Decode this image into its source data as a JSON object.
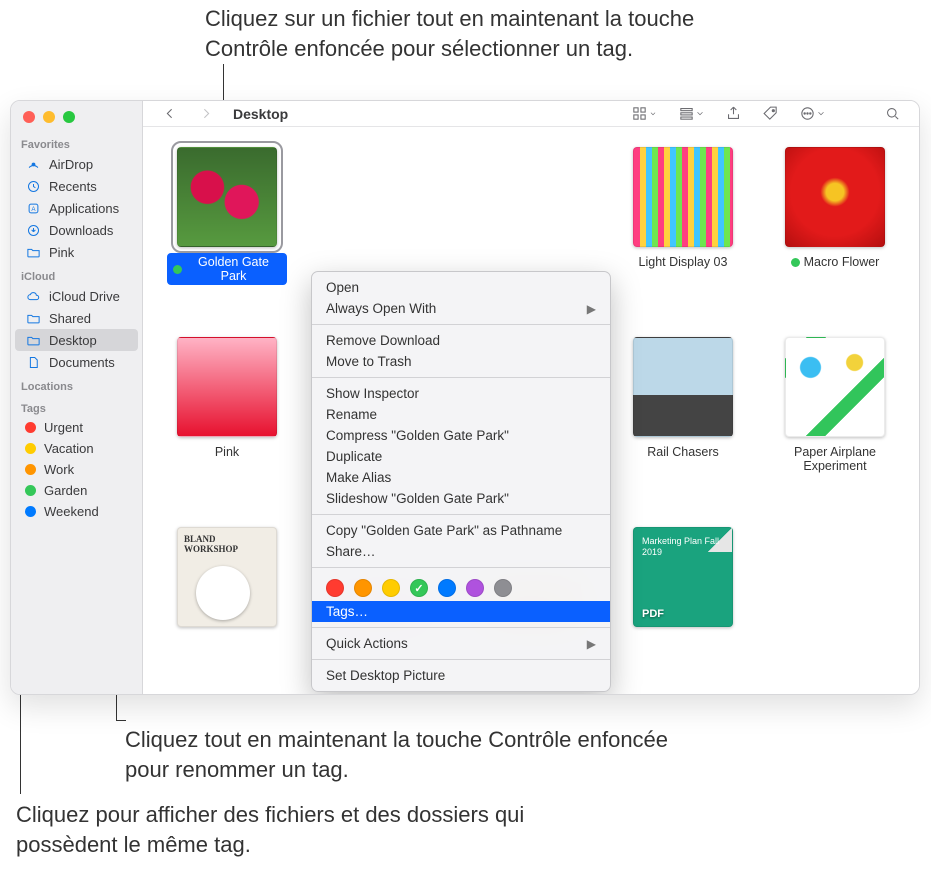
{
  "annotations": {
    "top": "Cliquez sur un fichier tout en maintenant la touche Contrôle enfoncée pour sélectionner un tag.",
    "mid": "Cliquez tout en maintenant la touche Contrôle enfoncée pour renommer un tag.",
    "bottom": "Cliquez pour afficher des fichiers et des dossiers qui possèdent le même tag."
  },
  "toolbar": {
    "title": "Desktop"
  },
  "sidebar": {
    "sections": [
      {
        "header": "Favorites",
        "items": [
          {
            "label": "AirDrop",
            "icon": "airdrop"
          },
          {
            "label": "Recents",
            "icon": "clock"
          },
          {
            "label": "Applications",
            "icon": "app"
          },
          {
            "label": "Downloads",
            "icon": "download"
          },
          {
            "label": "Pink",
            "icon": "folder"
          }
        ]
      },
      {
        "header": "iCloud",
        "items": [
          {
            "label": "iCloud Drive",
            "icon": "cloud"
          },
          {
            "label": "Shared",
            "icon": "folder"
          },
          {
            "label": "Desktop",
            "icon": "folder",
            "selected": true
          },
          {
            "label": "Documents",
            "icon": "doc"
          }
        ]
      },
      {
        "header": "Locations",
        "items": []
      },
      {
        "header": "Tags",
        "items": [
          {
            "label": "Urgent",
            "color": "#ff3b30"
          },
          {
            "label": "Vacation",
            "color": "#ffcc00"
          },
          {
            "label": "Work",
            "color": "#ff9500"
          },
          {
            "label": "Garden",
            "color": "#34c759"
          },
          {
            "label": "Weekend",
            "color": "#007aff"
          }
        ]
      }
    ]
  },
  "files": [
    {
      "label": "Golden Gate Park",
      "thumb": "t-flower",
      "selected": true,
      "tag": "#34c759"
    },
    {
      "label": "",
      "thumb": ""
    },
    {
      "label": "",
      "thumb": ""
    },
    {
      "label": "Light Display 03",
      "thumb": "t-stripes"
    },
    {
      "label": "Macro Flower",
      "thumb": "t-macro",
      "tag": "#34c759"
    },
    {
      "label": "Pink",
      "thumb": "t-pink"
    },
    {
      "label": "",
      "thumb": ""
    },
    {
      "label": "",
      "thumb": ""
    },
    {
      "label": "Rail Chasers",
      "thumb": "t-skate"
    },
    {
      "label": "Paper Airplane Experiment",
      "thumb": "t-paper"
    },
    {
      "label": "",
      "thumb": "t-bland"
    },
    {
      "label": "",
      "thumb": "t-pdf1",
      "pdf": true
    },
    {
      "label": "",
      "thumb": "t-pdf2",
      "pdf": true
    },
    {
      "label": "",
      "thumb": "t-pdf3",
      "pdf": true,
      "pdfText": "Marketing Plan Fall 2019"
    }
  ],
  "contextMenu": {
    "groups": [
      [
        {
          "label": "Open"
        },
        {
          "label": "Always Open With",
          "submenu": true
        }
      ],
      [
        {
          "label": "Remove Download"
        },
        {
          "label": "Move to Trash"
        }
      ],
      [
        {
          "label": "Show Inspector"
        },
        {
          "label": "Rename"
        },
        {
          "label": "Compress \"Golden Gate Park\""
        },
        {
          "label": "Duplicate"
        },
        {
          "label": "Make Alias"
        },
        {
          "label": "Slideshow \"Golden Gate Park\""
        }
      ],
      [
        {
          "label": "Copy \"Golden Gate Park\" as Pathname"
        },
        {
          "label": "Share…"
        }
      ]
    ],
    "tagColors": [
      {
        "c": "#ff3b30"
      },
      {
        "c": "#ff9500"
      },
      {
        "c": "#ffcc00"
      },
      {
        "c": "#34c759",
        "checked": true
      },
      {
        "c": "#007aff"
      },
      {
        "c": "#af52de"
      },
      {
        "c": "#8e8e93"
      }
    ],
    "tagsItem": "Tags…",
    "trailing": [
      {
        "label": "Quick Actions",
        "submenu": true
      },
      {
        "label": "Set Desktop Picture"
      }
    ]
  }
}
